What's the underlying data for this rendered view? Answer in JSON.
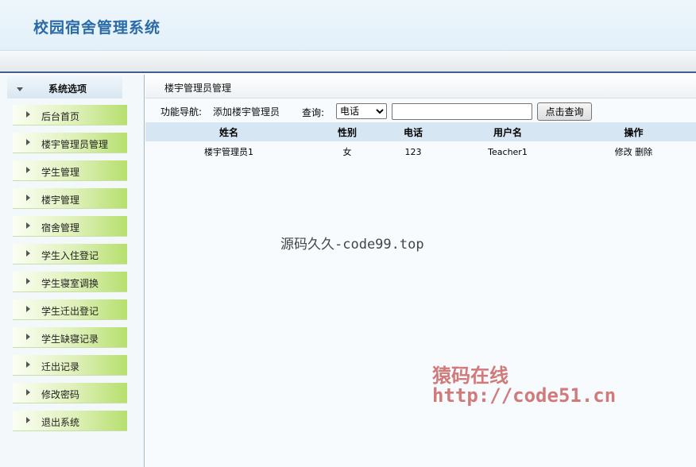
{
  "header": {
    "title": "校园宿舍管理系统"
  },
  "sidebar": {
    "section_title": "系统选项",
    "items": [
      {
        "label": "后台首页"
      },
      {
        "label": "楼宇管理员管理"
      },
      {
        "label": "学生管理"
      },
      {
        "label": "楼宇管理"
      },
      {
        "label": "宿舍管理"
      },
      {
        "label": "学生入住登记"
      },
      {
        "label": "学生寝室调换"
      },
      {
        "label": "学生迁出登记"
      },
      {
        "label": "学生缺寝记录"
      },
      {
        "label": "迁出记录"
      },
      {
        "label": "修改密码"
      },
      {
        "label": "退出系统"
      }
    ]
  },
  "main": {
    "breadcrumb": "楼宇管理员管理",
    "nav_label": "功能导航:",
    "nav_link": "添加楼宇管理员",
    "query_label": "查询:",
    "query_select": {
      "selected": "电话"
    },
    "search_value": "",
    "search_button": "点击查询",
    "table": {
      "headers": [
        "姓名",
        "性别",
        "电话",
        "用户名",
        "操作"
      ],
      "rows": [
        {
          "name": "楼宇管理员1",
          "gender": "女",
          "phone": "123",
          "username": "Teacher1",
          "edit": "修改",
          "delete": "删除"
        }
      ]
    }
  },
  "watermarks": {
    "line1": "源码久久-code99.top",
    "line2": "猿码在线",
    "line3": "http://code51.cn"
  }
}
